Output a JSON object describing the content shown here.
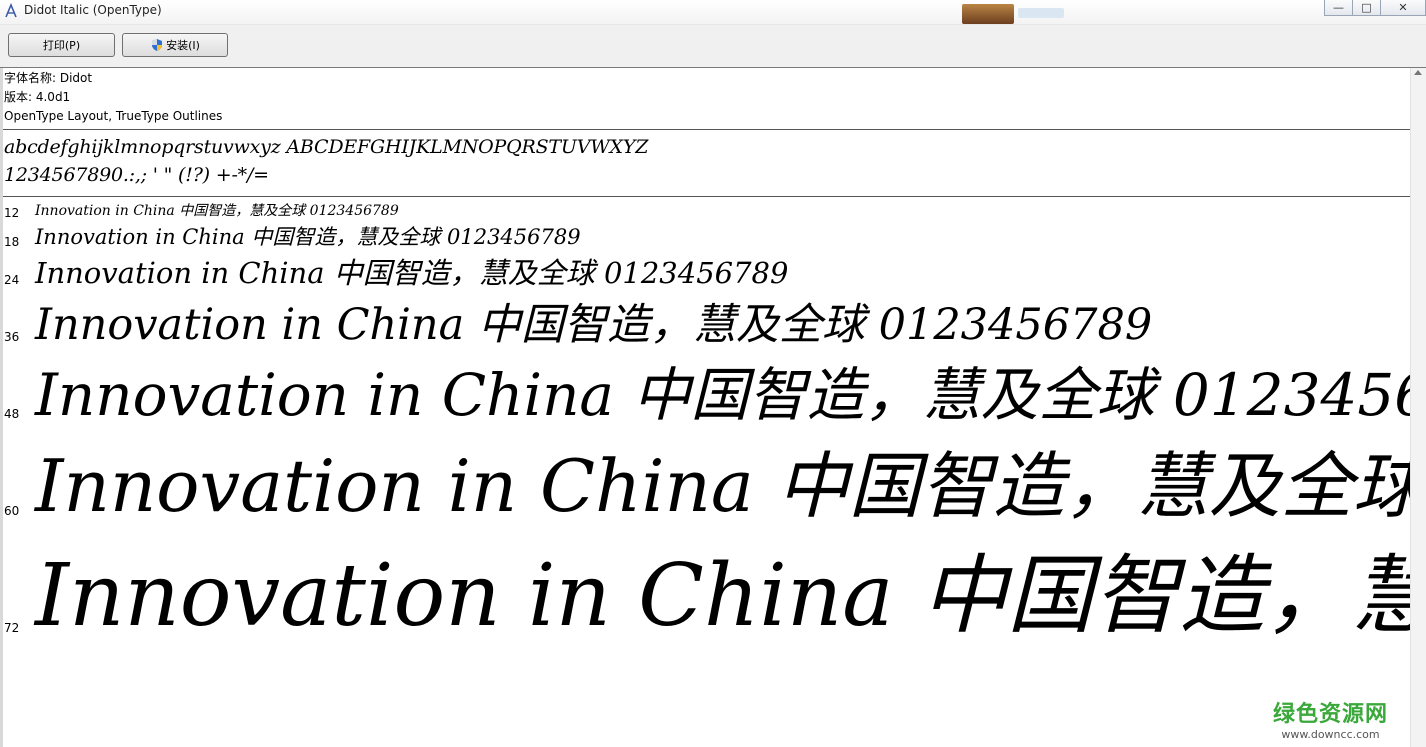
{
  "window": {
    "title": "Didot Italic (OpenType)",
    "controls": {
      "minimize": "—",
      "maximize": "□",
      "close": "✕"
    }
  },
  "toolbar": {
    "print_label": "打印(P)",
    "install_label": "安装(I)"
  },
  "font_info": {
    "name_line": "字体名称: Didot",
    "version_line": "版本: 4.0d1",
    "type_line": "OpenType Layout, TrueType Outlines"
  },
  "alphabet": {
    "letters": "abcdefghijklmnopqrstuvwxyz ABCDEFGHIJKLMNOPQRSTUVWXYZ",
    "digits_punct": "1234567890.:,; ' \" (!?) +-*/="
  },
  "samples": {
    "text": "Innovation in China  中国智造，慧及全球 0123456789",
    "rows": [
      {
        "size": "12"
      },
      {
        "size": "18"
      },
      {
        "size": "24"
      },
      {
        "size": "36"
      },
      {
        "size": "48"
      },
      {
        "size": "60"
      },
      {
        "size": "72"
      }
    ]
  },
  "watermark": {
    "title": "绿色资源网",
    "url": "www.downcc.com"
  }
}
